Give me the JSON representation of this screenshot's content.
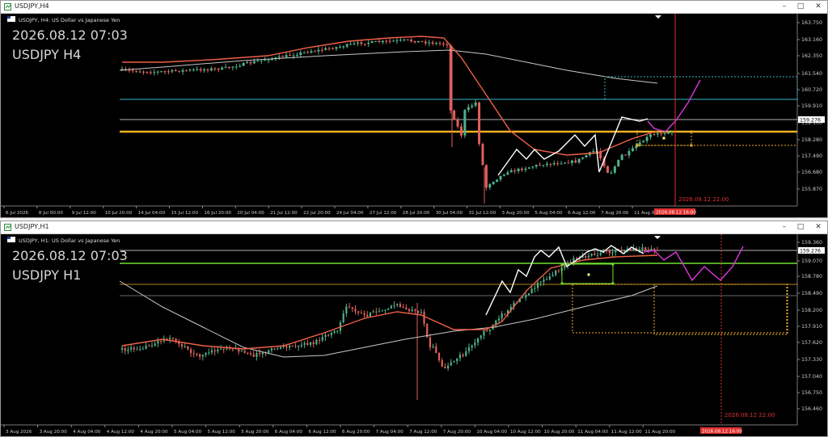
{
  "windows": [
    {
      "id": "h4",
      "title": "USDJPY,H4",
      "header_text": "USDJPY, H4:  US Dollar vs Japanese Yen",
      "watermark_date": "2026.08.12 07:03",
      "watermark_symbol": "USDJPY H4",
      "price_labels": [
        "163.750",
        "163.160",
        "162.350",
        "161.540",
        "160.720",
        "159.910",
        "159.276",
        "159.100",
        "158.280",
        "157.490",
        "156.680",
        "155.870"
      ],
      "current_price_tag": "159.276",
      "time_labels": [
        "6 Jul 2026",
        "8 Jul 00:00",
        "9 Jul 12:00",
        "10 Jul 20:00",
        "14 Jul 04:00",
        "15 Jul 12:00",
        "16 Jul 20:00",
        "20 Jul 04:00",
        "21 Jul 12:00",
        "22 Jul 20:00",
        "24 Jul 04:00",
        "27 Jul 12:00",
        "28 Jul 20:00",
        "30 Jul 04:00",
        "31 Jul 12:00",
        "3 Aug 20:00",
        "5 Aug 04:00",
        "6 Aug 12:00",
        "7 Aug 20:00",
        "11 Aug 04:00"
      ],
      "cursor_time_tag": "2026.08.12 16:00",
      "future_label": "2026.08.12 22:00"
    },
    {
      "id": "h1",
      "title": "USDJPY,H1",
      "header_text": "USDJPY, H1:  US Dollar vs Japanese Yen",
      "watermark_date": "2026.08.12 07:03",
      "watermark_symbol": "USDJPY H1",
      "price_labels": [
        "159.360",
        "159.276",
        "159.070",
        "158.780",
        "158.490",
        "158.200",
        "157.910",
        "157.620",
        "157.330",
        "157.040",
        "156.750",
        "156.460"
      ],
      "current_price_tag": "159.276",
      "time_labels": [
        "3 Aug 2026",
        "3 Aug 20:00",
        "4 Aug 04:00",
        "4 Aug 12:00",
        "4 Aug 20:00",
        "5 Aug 04:00",
        "5 Aug 12:00",
        "5 Aug 20:00",
        "6 Aug 04:00",
        "6 Aug 12:00",
        "6 Aug 20:00",
        "7 Aug 04:00",
        "7 Aug 12:00",
        "7 Aug 20:00",
        "10 Aug 04:00",
        "10 Aug 12:00",
        "10 Aug 20:00",
        "11 Aug 04:00",
        "11 Aug 12:00",
        "11 Aug 20:00"
      ],
      "cursor_time_tag": "2026.08.12 16:00",
      "future_label": "2026.08.12 22:00"
    }
  ],
  "colors": {
    "bull": "#4fb08a",
    "bear": "#e0605a",
    "ma_fast": "#f06048",
    "ma_slow": "#c8c8c8",
    "zigzag": "#ffffff",
    "forecast": "#d838d8",
    "level_gold": "#f0b020",
    "level_green": "#70e030",
    "level_cyan": "#3ab8c8",
    "cursor": "#e03030"
  }
}
